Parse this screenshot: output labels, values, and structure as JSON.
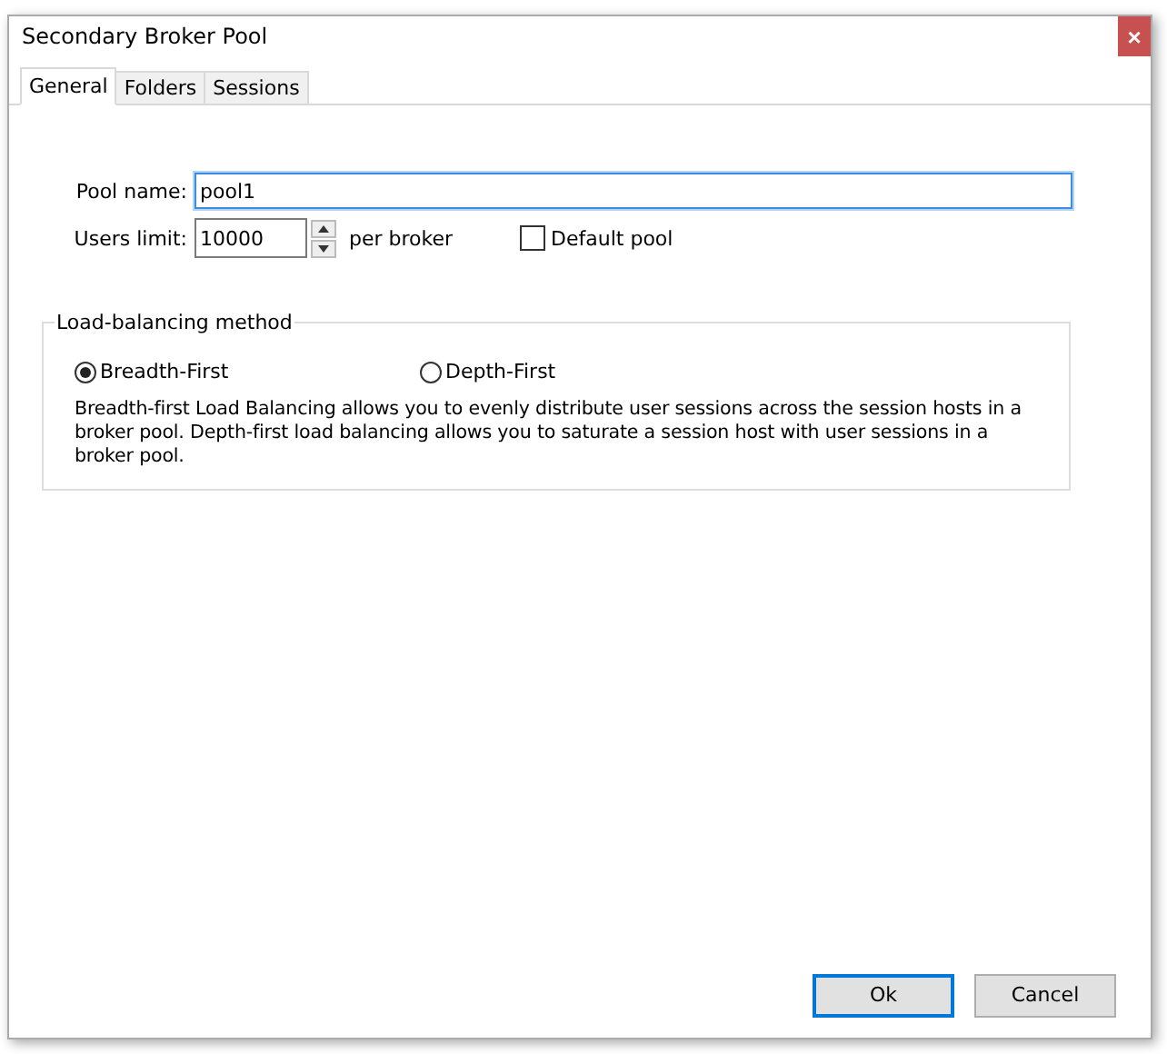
{
  "window": {
    "title": "Secondary Broker Pool",
    "close": "×"
  },
  "tabs": [
    {
      "label": "General",
      "selected": true
    },
    {
      "label": "Folders",
      "selected": false
    },
    {
      "label": "Sessions",
      "selected": false
    }
  ],
  "pool_name": {
    "label": "Pool name:",
    "value": "pool1"
  },
  "users_limit": {
    "label": "Users limit:",
    "value": "10000",
    "unit": "per broker"
  },
  "default_pool": {
    "label": "Default pool",
    "checked": false
  },
  "load_balancing": {
    "title": "Load-balancing method",
    "options": [
      {
        "label": "Breadth-First",
        "selected": true
      },
      {
        "label": "Depth-First",
        "selected": false
      }
    ],
    "description": "Breadth-first Load Balancing allows you to evenly distribute user sessions across the session hosts in a broker pool. Depth-first load balancing allows you to saturate a session host with user sessions in a broker pool."
  },
  "buttons": [
    {
      "label": "Ok",
      "default": true
    },
    {
      "label": "Cancel",
      "default": false
    }
  ]
}
